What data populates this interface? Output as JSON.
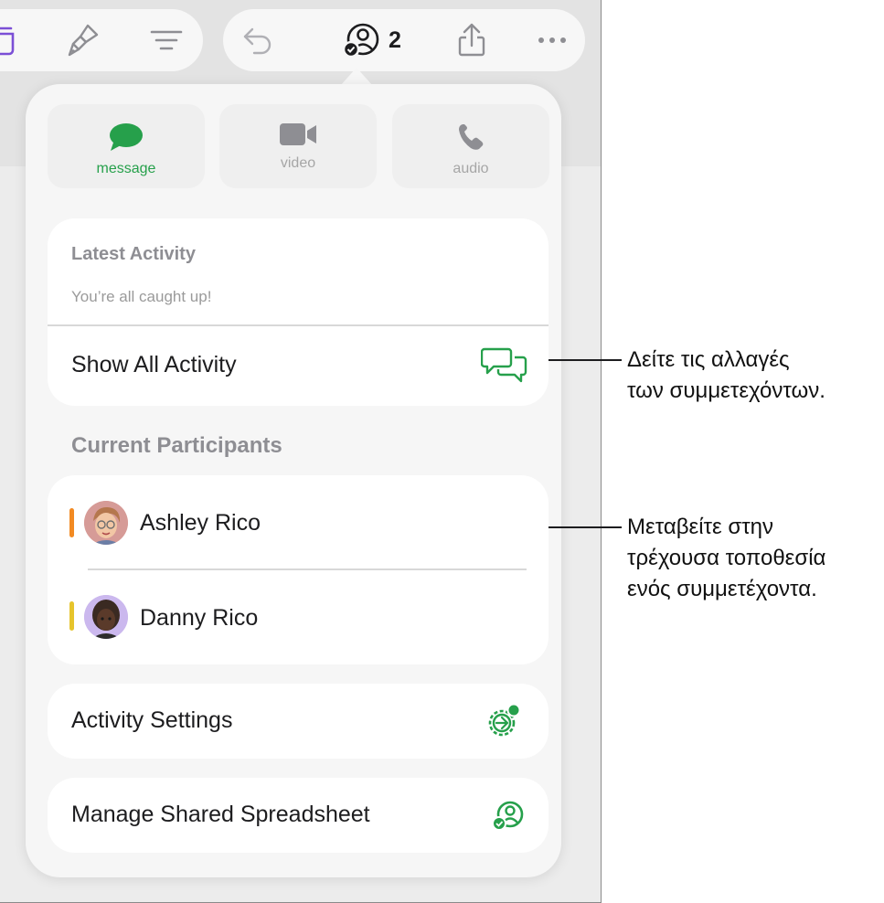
{
  "toolbar": {
    "collaborators_count": "2"
  },
  "communication": {
    "message_label": "message",
    "video_label": "video",
    "audio_label": "audio"
  },
  "activity": {
    "title": "Latest Activity",
    "status": "You’re all caught up!",
    "show_all_label": "Show All Activity"
  },
  "participants": {
    "title": "Current Participants",
    "items": [
      {
        "name": "Ashley Rico",
        "color": "#f28a22"
      },
      {
        "name": "Danny Rico",
        "color": "#e6c42c"
      }
    ]
  },
  "settings": {
    "activity_settings_label": "Activity Settings",
    "manage_label": "Manage Shared Spreadsheet"
  },
  "callouts": {
    "activity_line1": "Δείτε τις αλλαγές",
    "activity_line2": "των συμμετεχόντων.",
    "participant_line1": "Μεταβείτε στην",
    "participant_line2": "τρέχουσα τοποθεσία",
    "participant_line3": "ενός συμμετέχοντα."
  },
  "colors": {
    "accent_green": "#26a04b",
    "toolbar_icon_gray": "#8e8e93",
    "organize_purple": "#7b4fd6"
  },
  "icons": {
    "toolbar": [
      "organize-icon",
      "format-brush-icon",
      "sort-filter-icon",
      "undo-icon",
      "collaborate-icon",
      "share-icon",
      "more-icon"
    ],
    "communication": [
      "message-icon",
      "video-icon",
      "phone-icon"
    ],
    "rows": [
      "activity-bubbles-icon",
      "activity-settings-gear-icon",
      "manage-collaboration-icon"
    ]
  }
}
